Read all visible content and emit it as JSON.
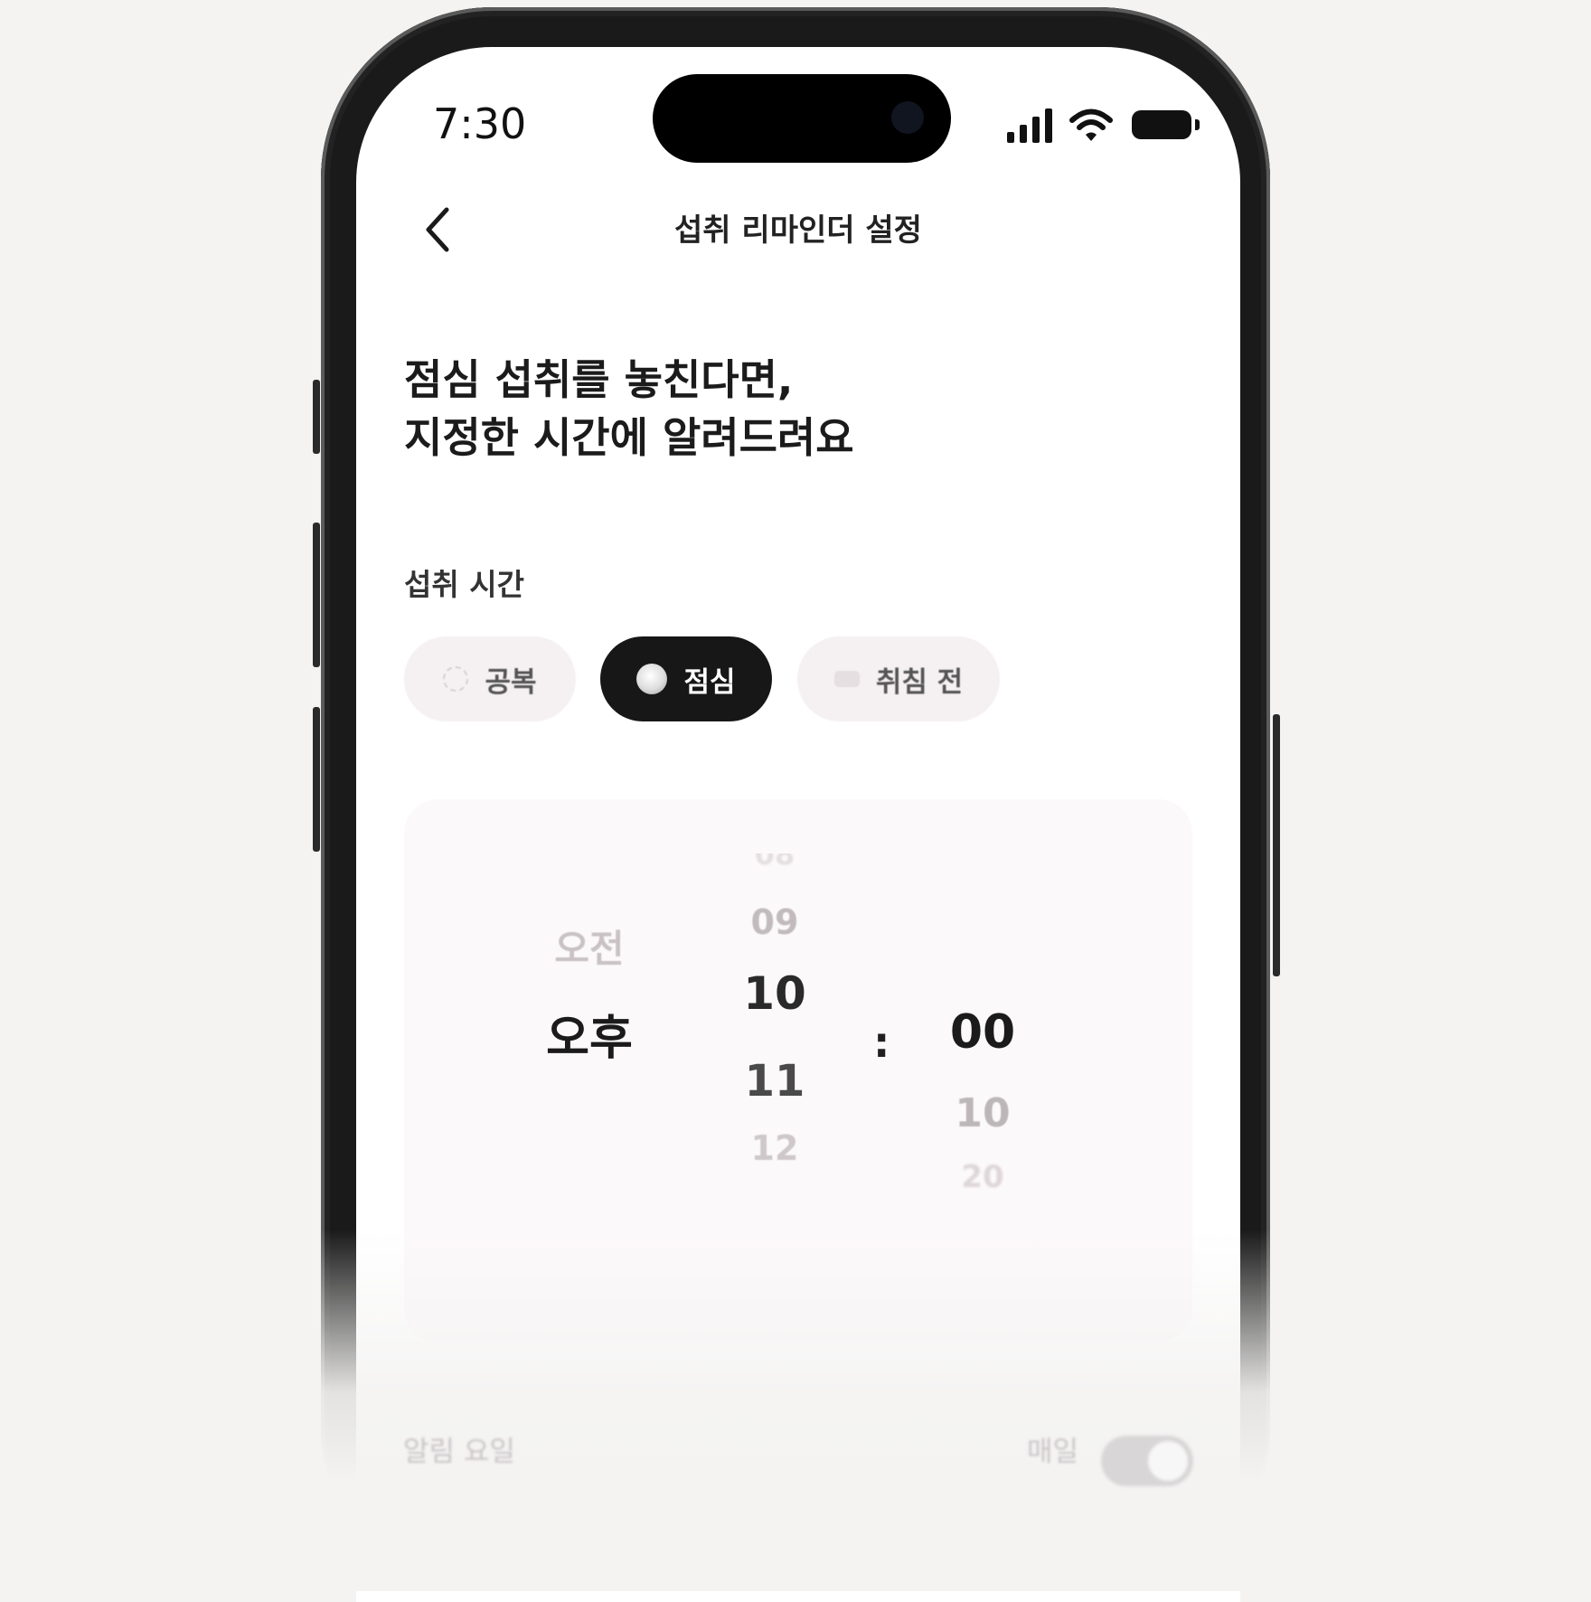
{
  "status_bar": {
    "time": "7:30"
  },
  "nav": {
    "title": "섭취 리마인더 설정"
  },
  "headline": {
    "line1": "점심 섭취를 놓친다면,",
    "line2": "지정한 시간에 알려드려요"
  },
  "section": {
    "label": "섭취 시간"
  },
  "chips": [
    {
      "label": "공복",
      "selected": false
    },
    {
      "label": "점심",
      "selected": true
    },
    {
      "label": "취침 전",
      "selected": false
    }
  ],
  "picker": {
    "ampm": {
      "options": [
        "오전",
        "오후"
      ],
      "selected": "오후"
    },
    "hour": {
      "options": [
        "09",
        "10",
        "11",
        "12"
      ],
      "selected": "10"
    },
    "separator": ":",
    "minute": {
      "options": [
        "00",
        "10",
        "20"
      ],
      "selected": "00"
    }
  },
  "footer": {
    "label": "알림 요일",
    "value": "매일",
    "toggle_on": true
  },
  "colors": {
    "accent": "#171717",
    "chip_bg": "#f5f0f2",
    "card_bg": "#fcf9fa"
  }
}
